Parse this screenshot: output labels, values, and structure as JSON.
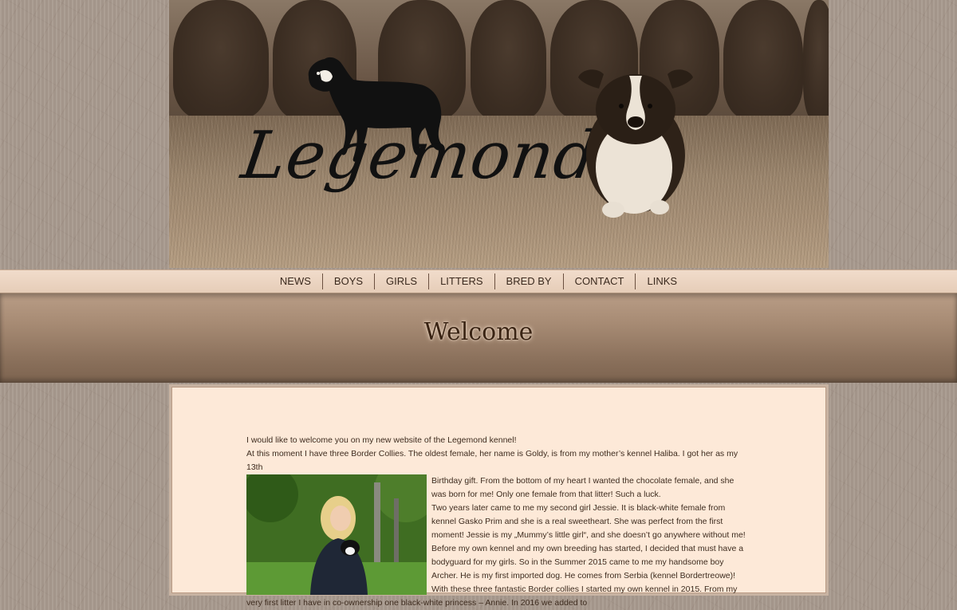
{
  "banner": {
    "logo_text": "Legemond"
  },
  "nav": {
    "items": [
      {
        "label": "NEWS"
      },
      {
        "label": "BOYS"
      },
      {
        "label": "GIRLS"
      },
      {
        "label": "LITTERS"
      },
      {
        "label": "BRED BY"
      },
      {
        "label": "CONTACT"
      },
      {
        "label": "LINKS"
      }
    ]
  },
  "page": {
    "title": "Welcome"
  },
  "content": {
    "line1": "I would like to welcome you on my new website of the Legemond kennel!",
    "line2": "At this moment I have three Border Collies. The oldest female, her name is Goldy, is from my mother’s kennel Haliba. I got her as my 13th",
    "para1": "Birthday gift. From the bottom of my heart I wanted the chocolate female, and she was born for me! Only one female from that litter! Such a luck.",
    "para2": "Two years later came to me my second girl Jessie. It is black-white female from kennel Gasko Prim and she is a real sweetheart. She was perfect from the first moment! Jessie is my „Mummy’s little girl“, and she doesn’t go anywhere without me!",
    "para3": "Before my own kennel and my own breeding has started, I decided that must have a bodyguard for my girls. So in the Summer 2015 came to me my handsome boy Archer. He is my first imported dog. He comes from Serbia (kennel Bordertreowe)!",
    "para4": "With these three fantastic Border collies I started my own kennel in 2015. From my very first litter I have in co-ownership one black-white princess – Annie. In 2016 we added to"
  },
  "colors": {
    "accent": "#3a2414",
    "panel": "#fde9d8",
    "nav_bg": "#e6cdb8"
  }
}
